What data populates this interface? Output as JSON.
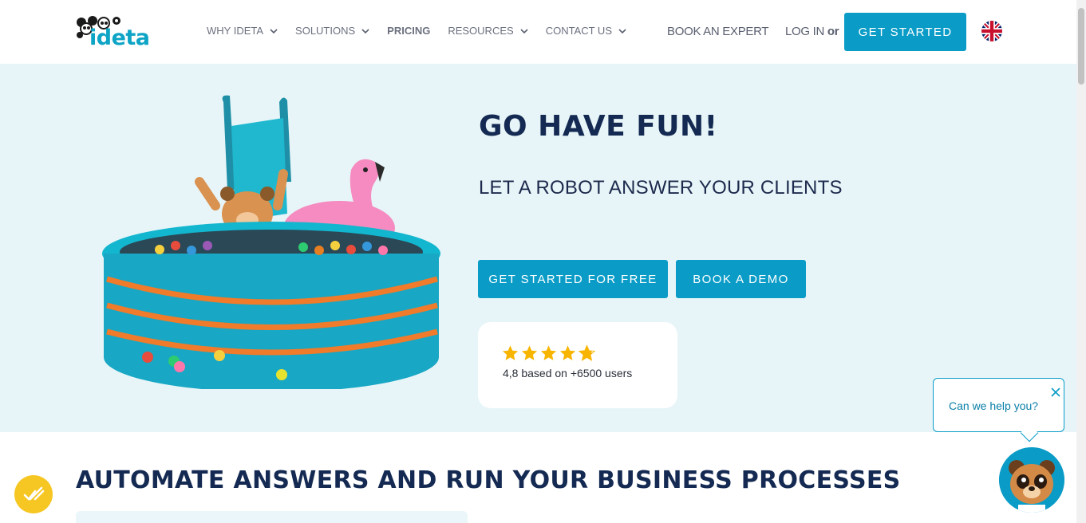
{
  "header": {
    "logo_text": "ideta",
    "nav": [
      {
        "label": "WHY IDETA",
        "dropdown": true
      },
      {
        "label": "SOLUTIONS",
        "dropdown": true
      },
      {
        "label": "PRICING",
        "dropdown": false
      },
      {
        "label": "RESOURCES",
        "dropdown": true
      },
      {
        "label": "CONTACT US",
        "dropdown": true
      }
    ],
    "book_expert": "BOOK AN EXPERT",
    "login": "LOG IN",
    "or": "or",
    "get_started": "GET STARTED",
    "language_icon": "uk-flag-icon"
  },
  "hero": {
    "title": "GO HAVE FUN!",
    "subtitle": "LET A ROBOT ANSWER YOUR CLIENTS",
    "cta_free": "GET STARTED FOR FREE",
    "cta_demo": "BOOK A DEMO",
    "rating": {
      "stars": 4.8,
      "max_stars": 5,
      "text": "4,8 based on +6500 users"
    }
  },
  "section": {
    "title": "AUTOMATE ANSWERS AND RUN YOUR BUSINESS PROCESSES"
  },
  "chat": {
    "bubble_text": "Can we help you?"
  },
  "colors": {
    "accent": "#0a9cc7",
    "hero_bg": "#e7f5f8",
    "heading": "#142a52",
    "star": "#f7b500",
    "badge": "#f6c623"
  }
}
